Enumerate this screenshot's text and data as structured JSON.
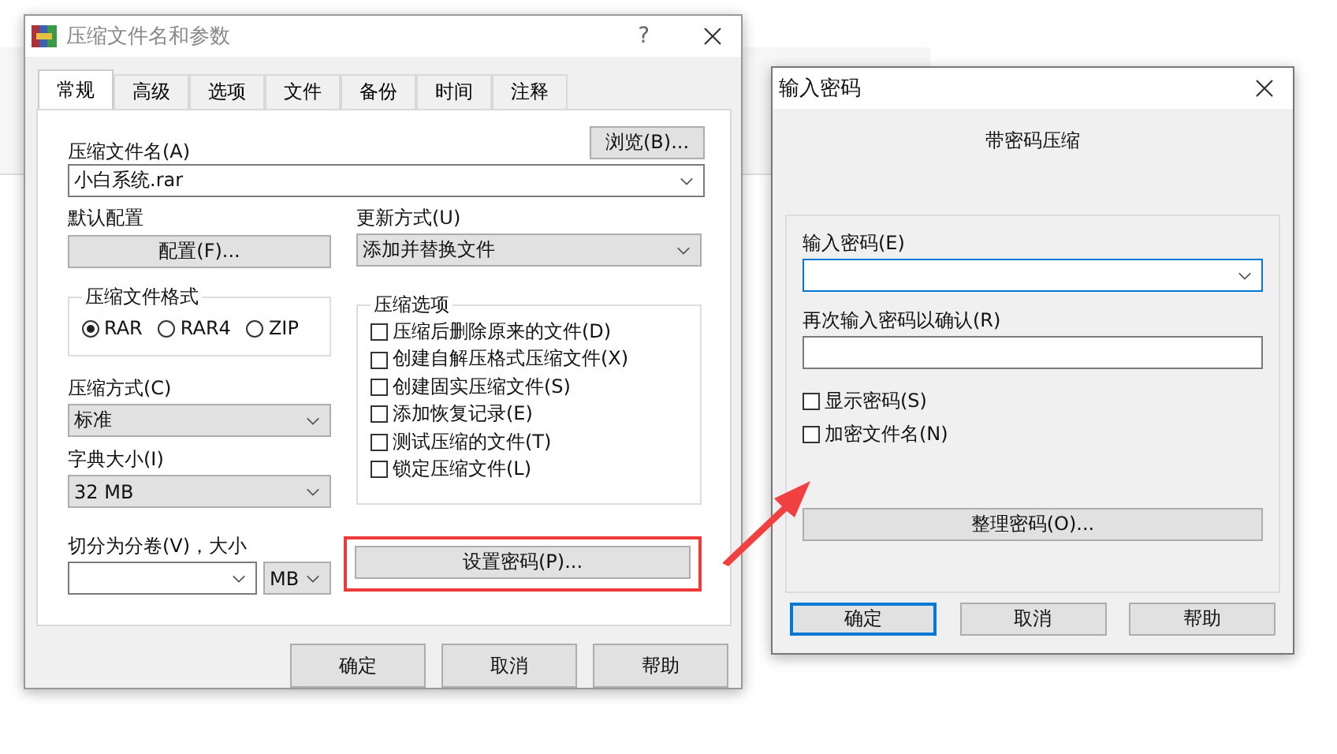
{
  "main_dialog": {
    "title": "压缩文件名和参数",
    "help_button": "?",
    "tabs": [
      {
        "label": "常规",
        "selected": true
      },
      {
        "label": "高级",
        "selected": false
      },
      {
        "label": "选项",
        "selected": false
      },
      {
        "label": "文件",
        "selected": false
      },
      {
        "label": "备份",
        "selected": false
      },
      {
        "label": "时间",
        "selected": false
      },
      {
        "label": "注释",
        "selected": false
      }
    ],
    "archive_name": {
      "label": "压缩文件名(A)",
      "value": "小白系统.rar"
    },
    "browse_button": "浏览(B)...",
    "profile": {
      "label": "默认配置",
      "button": "配置(F)..."
    },
    "update_mode": {
      "label": "更新方式(U)",
      "value": "添加并替换文件"
    },
    "format": {
      "label": "压缩文件格式",
      "options": [
        {
          "label": "RAR",
          "selected": true
        },
        {
          "label": "RAR4",
          "selected": false
        },
        {
          "label": "ZIP",
          "selected": false
        }
      ]
    },
    "method": {
      "label": "压缩方式(C)",
      "value": "标准"
    },
    "dictionary": {
      "label": "字典大小(I)",
      "value": "32 MB"
    },
    "split": {
      "label": "切分为分卷(V)，大小",
      "unit": "MB"
    },
    "options": {
      "label": "压缩选项",
      "items": [
        {
          "label": "压缩后删除原来的文件(D)",
          "checked": false
        },
        {
          "label": "创建自解压格式压缩文件(X)",
          "checked": false
        },
        {
          "label": "创建固实压缩文件(S)",
          "checked": false
        },
        {
          "label": "添加恢复记录(E)",
          "checked": false
        },
        {
          "label": "测试压缩的文件(T)",
          "checked": false
        },
        {
          "label": "锁定压缩文件(L)",
          "checked": false
        }
      ]
    },
    "password_button": {
      "label": "设置密码(P)...",
      "highlighted": true
    },
    "buttons": [
      "确定",
      "取消",
      "帮助"
    ]
  },
  "password_dialog": {
    "title": "输入密码",
    "heading": "带密码压缩",
    "password": {
      "label": "输入密码(E)",
      "focused": true
    },
    "confirm": {
      "label": "再次输入密码以确认(R)",
      "focused": false
    },
    "options": [
      {
        "label": "显示密码(S)",
        "checked": false
      },
      {
        "label": "加密文件名(N)",
        "checked": false
      }
    ],
    "organize_button": "整理密码(O)...",
    "buttons": [
      {
        "label": "确定",
        "default": true
      },
      {
        "label": "取消",
        "default": false
      },
      {
        "label": "帮助",
        "default": false
      }
    ]
  }
}
